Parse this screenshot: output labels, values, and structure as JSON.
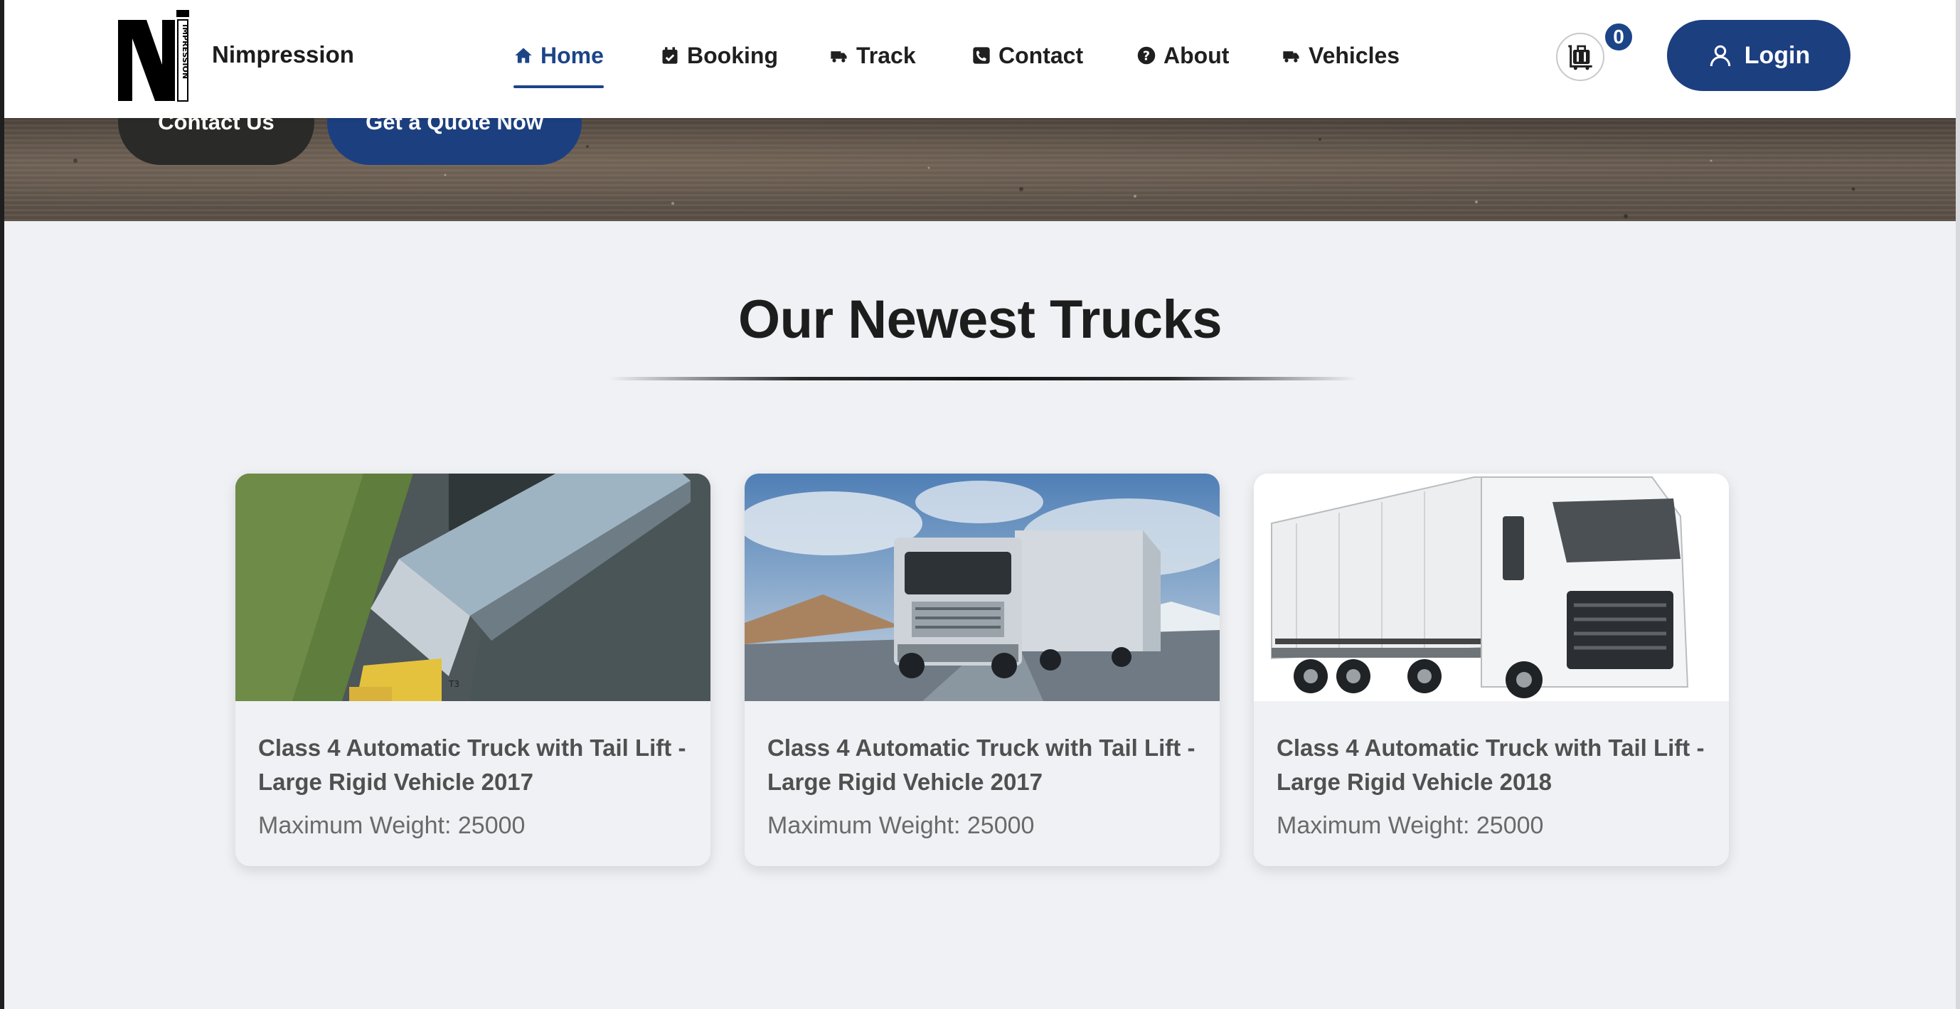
{
  "header": {
    "brand_name": "Nimpression",
    "logo_text": "IMPRESSION",
    "nav": [
      {
        "label": "Home",
        "icon": "home-icon",
        "active": true
      },
      {
        "label": "Booking",
        "icon": "calendar-check-icon",
        "active": false
      },
      {
        "label": "Track",
        "icon": "truck-fast-icon",
        "active": false
      },
      {
        "label": "Contact",
        "icon": "phone-icon",
        "active": false
      },
      {
        "label": "About",
        "icon": "question-circle-icon",
        "active": false
      },
      {
        "label": "Vehicles",
        "icon": "truck-fast-icon",
        "active": false
      }
    ],
    "cart_count": "0",
    "login_label": "Login"
  },
  "hero": {
    "contact_label": "Contact Us",
    "quote_label": "Get a Quote Now"
  },
  "section": {
    "title": "Our Newest Trucks"
  },
  "trucks": [
    {
      "title": "Class 4 Automatic Truck with Tail Lift - Large Rigid Vehicle 2017",
      "weight": "Maximum Weight: 25000",
      "image": "aerial-trailer-truck"
    },
    {
      "title": "Class 4 Automatic Truck with Tail Lift - Large Rigid Vehicle 2017",
      "weight": "Maximum Weight: 25000",
      "image": "silver-semi-truck-road"
    },
    {
      "title": "Class 4 Automatic Truck with Tail Lift - Large Rigid Vehicle 2018",
      "weight": "Maximum Weight: 25000",
      "image": "white-curtain-truck"
    }
  ],
  "colors": {
    "accent": "#1c4588",
    "button_blue": "#1c3f80",
    "button_dark": "#2a2b28",
    "page_bg": "#eff1f4"
  }
}
